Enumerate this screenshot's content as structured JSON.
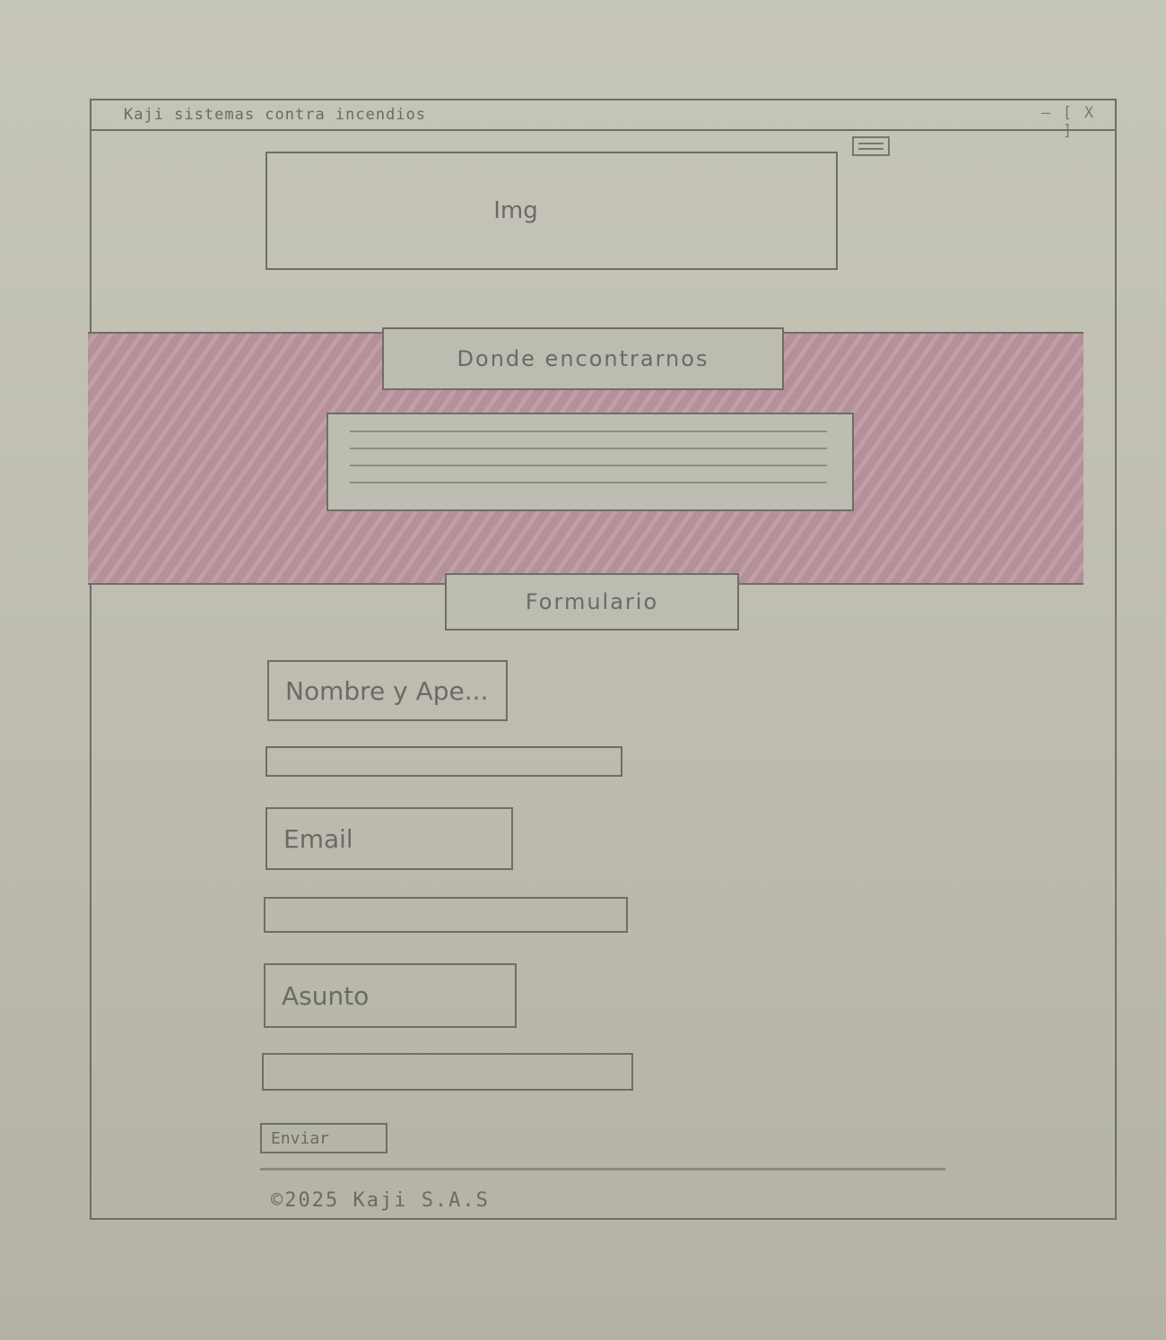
{
  "window": {
    "title": "Kaji sistemas contra incendios",
    "controls": {
      "minimize": "—",
      "maximize": "[ ]",
      "close": "X"
    }
  },
  "header": {
    "hero_image_label": "Img"
  },
  "location_section": {
    "title": "Donde encontrarnos",
    "text_lines": 4
  },
  "form_section": {
    "title": "Formulario",
    "fields": {
      "name": {
        "label": "Nombre y Ape...",
        "value": ""
      },
      "email": {
        "label": "Email",
        "value": ""
      },
      "subject": {
        "label": "Asunto",
        "value": ""
      }
    },
    "submit_label": "Enviar"
  },
  "footer": {
    "copyright": "©2025 Kaji S.A.S"
  },
  "colors": {
    "paper": "#c6c5b9",
    "pencil": "#6f6e66",
    "pink_band": "#b3909a"
  }
}
